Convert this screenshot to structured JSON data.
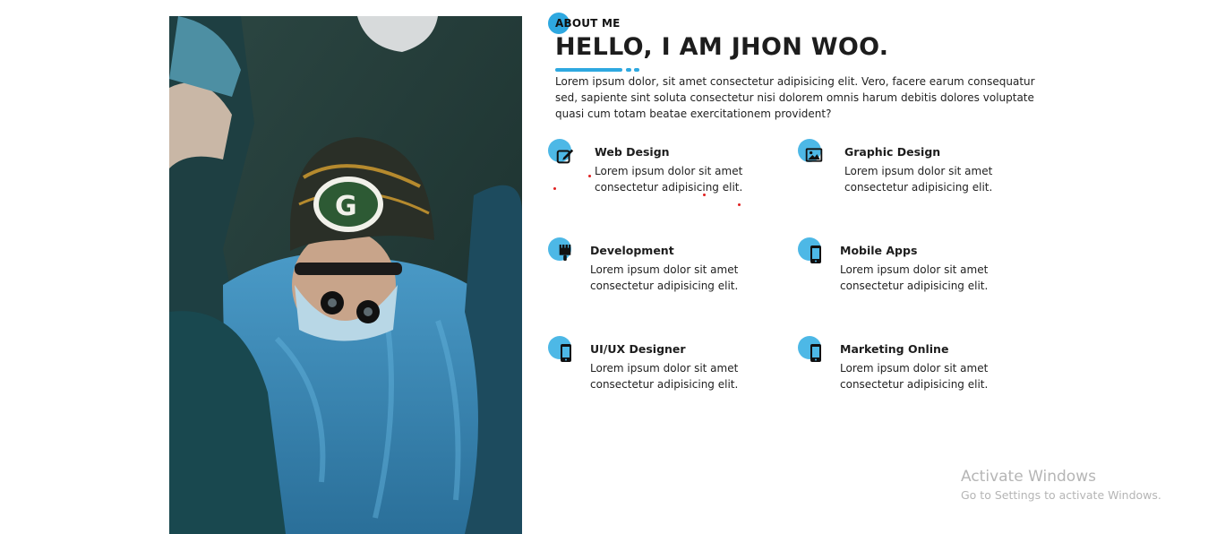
{
  "about": {
    "eyebrow": "ABOUT ME",
    "headline": "HELLO, I AM JHON WOO.",
    "intro": "Lorem ipsum dolor, sit amet consectetur adipisicing elit. Vero, facere earum consequatur sed, sapiente sint soluta consectetur nisi dolorem omnis harum debitis dolores voluptate quasi cum totam beatae exercitationem provident?"
  },
  "services": [
    {
      "title": "Web Design",
      "desc": "Lorem ipsum dolor sit amet consectetur adipisicing elit.",
      "icon": "edit-icon"
    },
    {
      "title": "Graphic Design",
      "desc": "Lorem ipsum dolor sit amet consectetur adipisicing elit.",
      "icon": "image-icon"
    },
    {
      "title": "Development",
      "desc": "Lorem ipsum dolor sit amet consectetur adipisicing elit.",
      "icon": "paint-brush-icon"
    },
    {
      "title": "Mobile Apps",
      "desc": "Lorem ipsum dolor sit amet consectetur adipisicing elit.",
      "icon": "mobile-icon"
    },
    {
      "title": "UI/UX Designer",
      "desc": "Lorem ipsum dolor sit amet consectetur adipisicing elit.",
      "icon": "mobile-icon"
    },
    {
      "title": "Marketing Online",
      "desc": "Lorem ipsum dolor sit amet consectetur adipisicing elit.",
      "icon": "mobile-icon"
    }
  ],
  "watermark": {
    "title": "Activate Windows",
    "subtitle": "Go to Settings to activate Windows."
  },
  "colors": {
    "accent": "#2ea8e0",
    "icon_bubble": "#4db8e6",
    "text": "#1d1d1d"
  }
}
